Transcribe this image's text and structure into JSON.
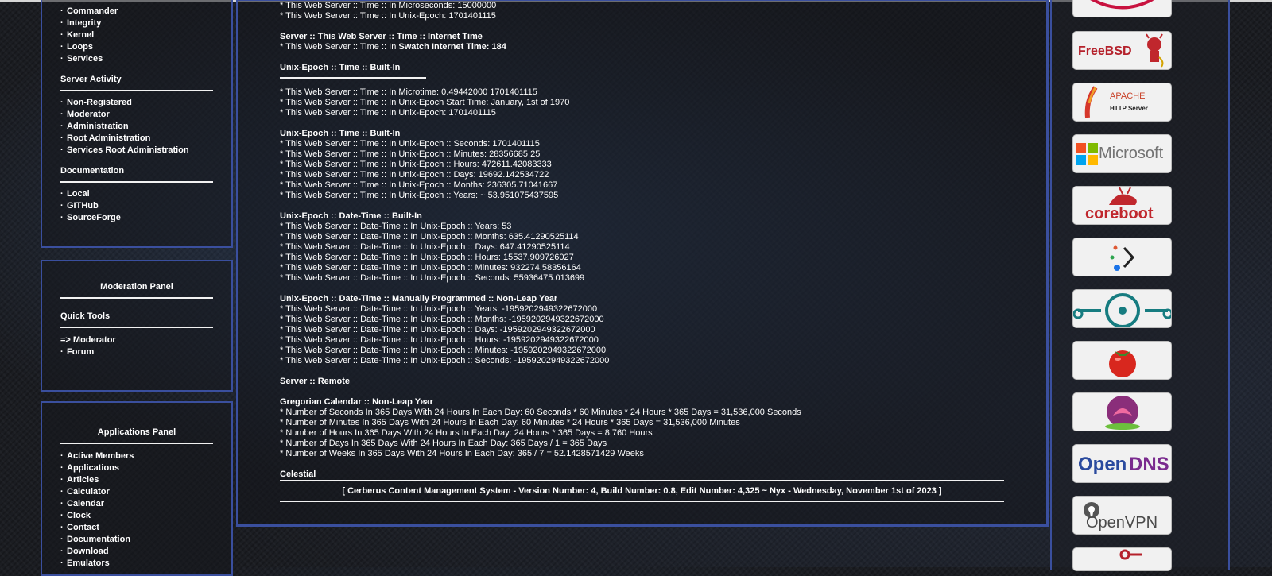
{
  "left_panel_1": {
    "items_top": [
      "Commander",
      "Integrity",
      "Kernel",
      "Loops",
      "Services"
    ],
    "server_activity": {
      "title": "Server Activity",
      "items": [
        "Non-Registered",
        "Moderator",
        "Administration",
        "Root Administration",
        "Services Root Administration"
      ]
    },
    "documentation": {
      "title": "Documentation",
      "items": [
        "Local",
        "GITHub",
        "SourceForge"
      ]
    }
  },
  "moderation_panel": {
    "title": "Moderation Panel",
    "quick_tools": "Quick Tools",
    "items": [
      {
        "prefix": "=>",
        "label": "Moderator"
      },
      {
        "prefix": "·",
        "label": "Forum"
      }
    ]
  },
  "applications_panel": {
    "title": "Applications Panel",
    "items": [
      "Active Members",
      "Applications",
      "Articles",
      "Calculator",
      "Calendar",
      "Clock",
      "Contact",
      "Documentation",
      "Download",
      "Emulators"
    ]
  },
  "main": {
    "lines_top": [
      "* This Web Server :: Time :: In Microseconds: 15000000",
      "* This Web Server :: Time :: In Unix-Epoch: 1701401115"
    ],
    "internet_time_header": "Server :: This Web Server :: Time :: Internet Time",
    "internet_time_prefix": "* This Web Server :: Time :: In ",
    "internet_time_value": "Swatch Internet Time: 184",
    "builtin_header_1": "Unix-Epoch :: Time :: Built-In",
    "builtin_lines_1": [
      "* This Web Server :: Time :: In Microtime: 0.49442000 1701401115",
      "* This Web Server :: Time :: In Unix-Epoch Start Time: January, 1st of 1970",
      "* This Web Server :: Time :: In Unix-Epoch: 1701401115"
    ],
    "builtin_header_2": "Unix-Epoch :: Time :: Built-In",
    "builtin_lines_2": [
      "* This Web Server :: Time :: In Unix-Epoch :: Seconds: 1701401115",
      "* This Web Server :: Time :: In Unix-Epoch :: Minutes: 28356685.25",
      "* This Web Server :: Time :: In Unix-Epoch :: Hours: 472611.42083333",
      "* This Web Server :: Time :: In Unix-Epoch :: Days: 19692.142534722",
      "* This Web Server :: Time :: In Unix-Epoch :: Months: 236305.71041667",
      "* This Web Server :: Time :: In Unix-Epoch :: Years: ~ 53.951075437595"
    ],
    "datetime_header": "Unix-Epoch :: Date-Time :: Built-In",
    "datetime_lines": [
      "* This Web Server :: Date-Time :: In Unix-Epoch :: Years: 53",
      "* This Web Server :: Date-Time :: In Unix-Epoch :: Months: 635.41290525114",
      "* This Web Server :: Date-Time :: In Unix-Epoch :: Days: 647.41290525114",
      "* This Web Server :: Date-Time :: In Unix-Epoch :: Hours: 15537.909726027",
      "* This Web Server :: Date-Time :: In Unix-Epoch :: Minutes: 932274.58356164",
      "* This Web Server :: Date-Time :: In Unix-Epoch :: Seconds: 55936475.013699"
    ],
    "manual_header": "Unix-Epoch :: Date-Time :: Manually Programmed :: Non-Leap Year",
    "manual_lines": [
      "* This Web Server :: Date-Time :: In Unix-Epoch :: Years: -1959202949322672000",
      "* This Web Server :: Date-Time :: In Unix-Epoch :: Months: -1959202949322672000",
      "* This Web Server :: Date-Time :: In Unix-Epoch :: Days: -1959202949322672000",
      "* This Web Server :: Date-Time :: In Unix-Epoch :: Hours: -1959202949322672000",
      "* This Web Server :: Date-Time :: In Unix-Epoch :: Minutes: -1959202949322672000",
      "* This Web Server :: Date-Time :: In Unix-Epoch :: Seconds: -1959202949322672000"
    ],
    "remote_header": "Server :: Remote",
    "gregorian_header": "Gregorian Calendar :: Non-Leap Year",
    "gregorian_lines": [
      "* Number of Seconds In 365 Days With 24 Hours In Each Day: 60 Seconds * 60 Minutes * 24 Hours * 365 Days = 31,536,000 Seconds",
      "* Number of Minutes In 365 Days With 24 Hours In Each Day: 60 Minutes * 24 Hours * 365 Days = 31,536,000 Minutes",
      "* Number of Hours In 365 Days With 24 Hours In Each Day: 24 Hours * 365 Days = 8,760 Hours",
      "* Number of Days In 365 Days With 24 Hours In Each Day: 365 Days / 1 = 365 Days",
      "* Number of Weeks In 365 Days With 24 Hours In Each Day: 365 / 7 = 52.1428571429 Weeks"
    ],
    "celestial_header": "Celestial",
    "footer": "[ Cerberus Content Management System - Version Number: 4, Build Number: 0.8, Edit Number: 4,325 ~ Nyx - Wednesday, November 1st of 2023 ]"
  },
  "badges": {
    "freebsd": "FreeBSD",
    "apache_1": "APACHE",
    "apache_2": "HTTP Server",
    "microsoft": "Microsoft",
    "coreboot": "coreboot",
    "opendns_1": "Open",
    "opendns_2": "DNS",
    "openvpn": "OpenVPN"
  },
  "colors": {
    "panel_border": "#3a4f9e",
    "freebsd_red": "#b5212b",
    "opendns_blue": "#2a4a9e",
    "coreboot_red": "#c0272d"
  }
}
